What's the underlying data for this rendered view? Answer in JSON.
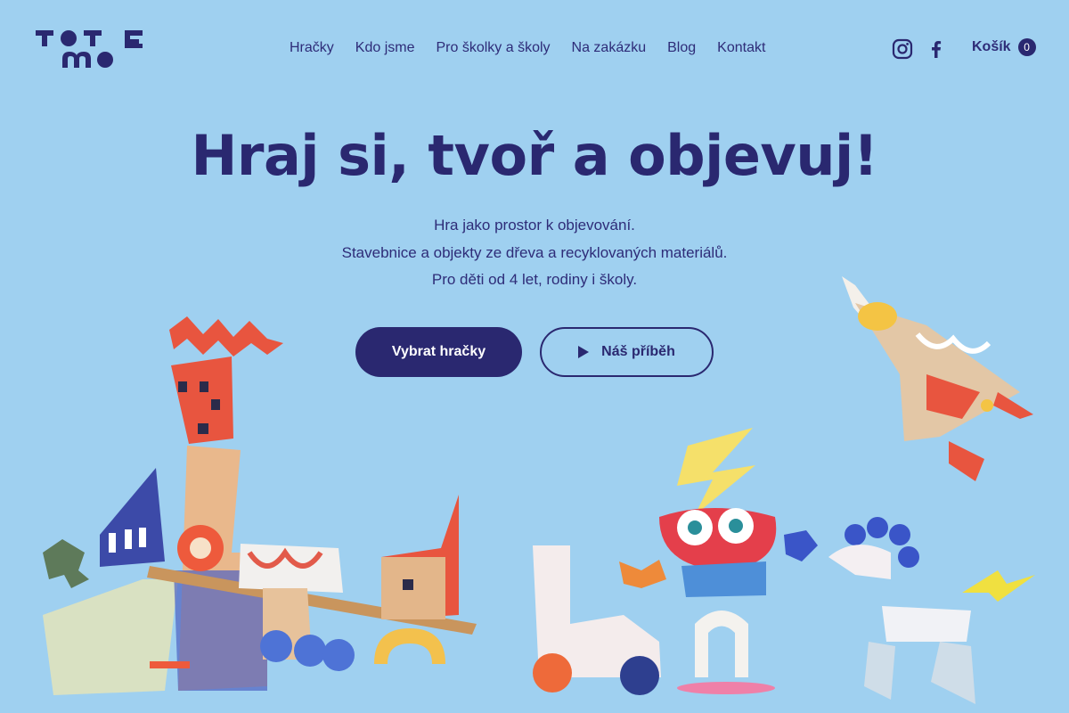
{
  "brand": {
    "logo_letters": [
      "T",
      "O",
      "T",
      "E",
      "M",
      "O"
    ],
    "primary_color": "#2a2870",
    "background_color": "#9fd0f0"
  },
  "nav": {
    "items": [
      {
        "label": "Hračky"
      },
      {
        "label": "Kdo jsme"
      },
      {
        "label": "Pro školky a školy"
      },
      {
        "label": "Na zakázku"
      },
      {
        "label": "Blog"
      },
      {
        "label": "Kontakt"
      }
    ]
  },
  "social": {
    "icons": [
      "instagram-icon",
      "facebook-icon"
    ]
  },
  "cart": {
    "label": "Košík",
    "count": "0"
  },
  "hero": {
    "title": "Hraj si, tvoř a objevuj!",
    "lines": [
      "Hra jako prostor k objevování.",
      "Stavebnice a objekty ze dřeva a recyklovaných materiálů.",
      "Pro děti od 4 let, rodiny i školy."
    ],
    "primary_button": "Vybrat hračky",
    "secondary_button": "Náš příběh"
  }
}
